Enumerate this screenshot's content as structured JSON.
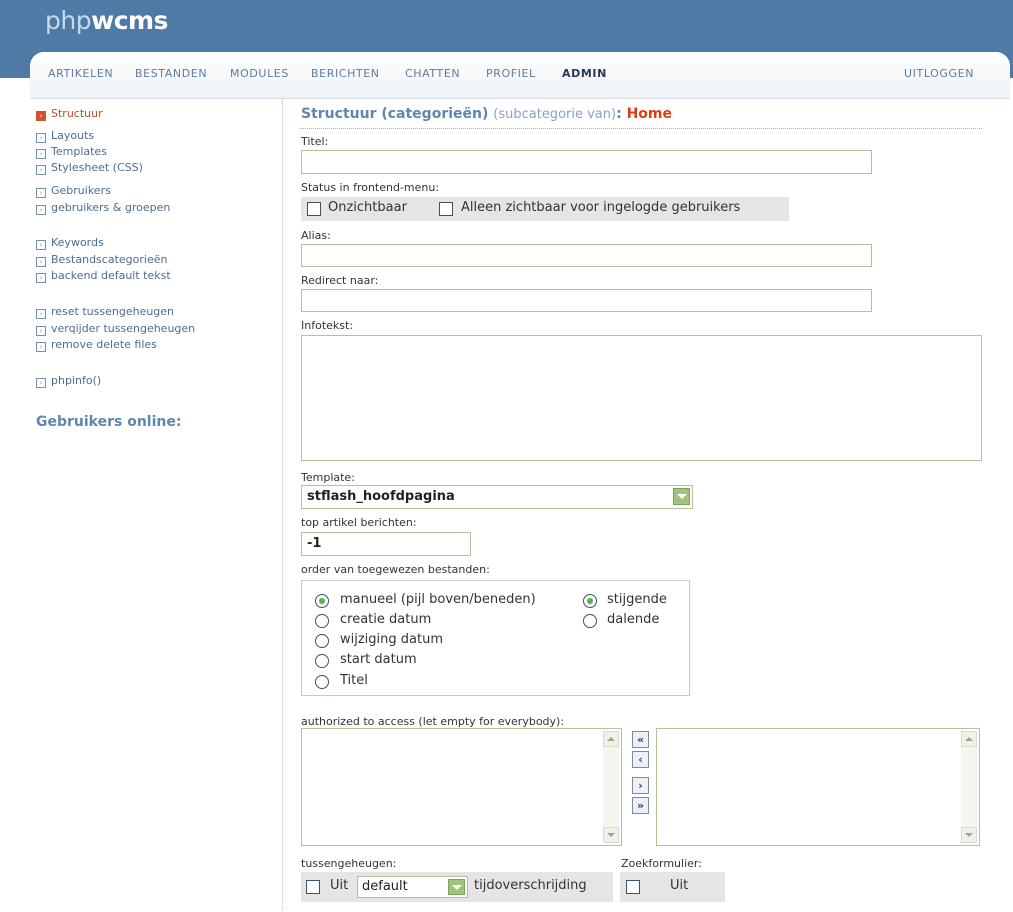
{
  "app": {
    "logo_light": "php",
    "logo_bold": "wcms"
  },
  "nav": {
    "items": [
      "ARTIKELEN",
      "BESTANDEN",
      "MODULES",
      "BERICHTEN",
      "CHATTEN",
      "PROFIEL",
      "ADMIN"
    ],
    "active": "ADMIN",
    "logout": "UITLOGGEN"
  },
  "sidebar": {
    "items": [
      {
        "label": "Structuur",
        "active": true
      },
      {
        "label": "Layouts"
      },
      {
        "label": "Templates"
      },
      {
        "label": "Stylesheet (CSS)"
      },
      {
        "label": "Gebruikers"
      },
      {
        "label": "gebruikers & groepen"
      },
      {
        "label": "Keywords"
      },
      {
        "label": "Bestandscategorieën"
      },
      {
        "label": "backend default tekst"
      },
      {
        "label": "reset tussengeheugen"
      },
      {
        "label": "verqijder tussengeheugen"
      },
      {
        "label": "remove delete files"
      },
      {
        "label": "phpinfo()"
      }
    ],
    "users_online": "Gebruikers online:"
  },
  "form": {
    "heading": "Structuur (categorieën)",
    "heading_sub": "(subcategorie van)",
    "heading_sep": ":",
    "heading_target": "Home",
    "titel_label": "Titel:",
    "titel_value": "",
    "status_label": "Status in frontend-menu:",
    "status_invisible": "Onzichtbaar",
    "status_logged_in": "Alleen zichtbaar voor ingelogde gebruikers",
    "alias_label": "Alias:",
    "alias_value": "",
    "redirect_label": "Redirect naar:",
    "redirect_value": "",
    "infotext_label": "Infotekst:",
    "infotext_value": "",
    "template_label": "Template:",
    "template_value": "stflash_hoofdpagina",
    "top_label": "top artikel berichten:",
    "top_value": "-1",
    "order_label": "order van toegewezen bestanden:",
    "order_options": [
      "manueel (pijl boven/beneden)",
      "creatie datum",
      "wijziging datum",
      "start datum",
      "Titel"
    ],
    "order_selected": "manueel (pijl boven/beneden)",
    "direction_options": [
      "stijgende",
      "dalende"
    ],
    "direction_selected": "stijgende",
    "access_label": "authorized to access (let empty for everybody):",
    "move_buttons": [
      "«",
      "‹",
      "›",
      "»"
    ],
    "cache_label": "tussengeheugen:",
    "cache_off": "Uit",
    "cache_select": "default",
    "cache_timeout": "tijdoverschrijding",
    "search_label": "Zoekformulier:",
    "search_off": "Uit"
  }
}
